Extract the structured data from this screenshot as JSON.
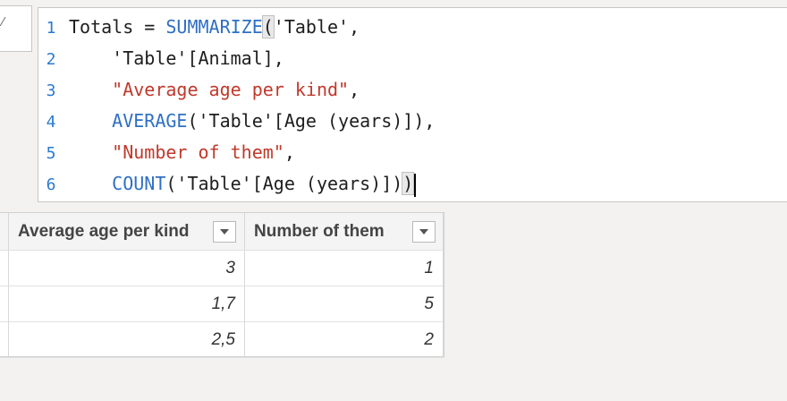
{
  "editor": {
    "lines": [
      {
        "number": "1",
        "parts": [
          {
            "text": "Totals = ",
            "kind": "plain"
          },
          {
            "text": "SUMMARIZE",
            "kind": "keyword"
          },
          {
            "text": "(",
            "kind": "paren-highlight"
          },
          {
            "text": "'Table',",
            "kind": "plain"
          }
        ]
      },
      {
        "number": "2",
        "parts": [
          {
            "text": "    'Table'[Animal],",
            "kind": "plain"
          }
        ]
      },
      {
        "number": "3",
        "parts": [
          {
            "text": "    ",
            "kind": "plain"
          },
          {
            "text": "\"Average age per kind\"",
            "kind": "string"
          },
          {
            "text": ",",
            "kind": "plain"
          }
        ]
      },
      {
        "number": "4",
        "parts": [
          {
            "text": "    ",
            "kind": "plain"
          },
          {
            "text": "AVERAGE",
            "kind": "keyword"
          },
          {
            "text": "('Table'[Age (years)]),",
            "kind": "plain"
          }
        ]
      },
      {
        "number": "5",
        "parts": [
          {
            "text": "    ",
            "kind": "plain"
          },
          {
            "text": "\"Number of them\"",
            "kind": "string"
          },
          {
            "text": ",",
            "kind": "plain"
          }
        ]
      },
      {
        "number": "6",
        "parts": [
          {
            "text": "    ",
            "kind": "plain"
          },
          {
            "text": "COUNT",
            "kind": "keyword"
          },
          {
            "text": "('Table'[Age (years)])",
            "kind": "plain"
          },
          {
            "text": ")",
            "kind": "paren-highlight"
          }
        ],
        "cursor": true
      }
    ]
  },
  "table": {
    "columns": [
      {
        "label": "Average age per kind",
        "icon": "dropdown-arrow-icon"
      },
      {
        "label": "Number of them",
        "icon": "dropdown-arrow-icon"
      }
    ],
    "rows": [
      [
        "3",
        "1"
      ],
      [
        "1,7",
        "5"
      ],
      [
        "2,5",
        "2"
      ]
    ]
  },
  "colors": {
    "keyword": "#2f6fc5",
    "string": "#c0392b",
    "line_number": "#2b7bd1"
  }
}
